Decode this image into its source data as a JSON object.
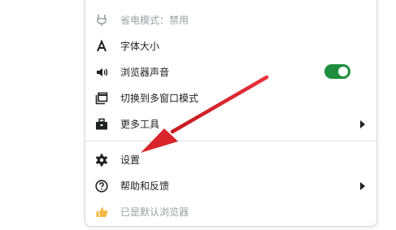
{
  "menu": {
    "items": [
      {
        "id": "power-mode",
        "label": "省电模式：禁用",
        "icon": "plug-icon",
        "disabled": true
      },
      {
        "id": "font-size",
        "label": "字体大小",
        "icon": "font-a-icon"
      },
      {
        "id": "browser-sound",
        "label": "浏览器声音",
        "icon": "speaker-icon",
        "toggle": true
      },
      {
        "id": "multi-window",
        "label": "切换到多窗口模式",
        "icon": "windows-icon"
      },
      {
        "id": "more-tools",
        "label": "更多工具",
        "icon": "toolbox-icon",
        "submenu": true
      },
      {
        "id": "settings",
        "label": "设置",
        "icon": "gear-icon"
      },
      {
        "id": "help-feedback",
        "label": "帮助和反馈",
        "icon": "help-circle-icon",
        "submenu": true
      },
      {
        "id": "default-browser",
        "label": "已是默认浏览器",
        "icon": "thumbs-up-icon",
        "disabled": true
      }
    ],
    "toggle_state": "on"
  },
  "colors": {
    "arrow": "#d9262c",
    "toggle": "#1e8e3e",
    "default_browser_icon": "#f5b942"
  }
}
